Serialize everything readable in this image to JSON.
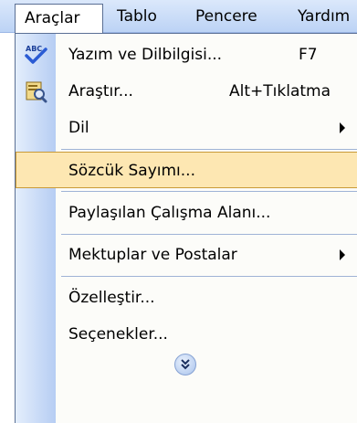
{
  "menubar": {
    "items": [
      {
        "label": "Araçlar"
      },
      {
        "label": "Tablo"
      },
      {
        "label": "Pencere"
      },
      {
        "label": "Yardım"
      }
    ]
  },
  "menu": {
    "items": [
      {
        "label": "Yazım ve Dilbilgisi...",
        "shortcut": "F7",
        "icon": "spelling-check-icon"
      },
      {
        "label": "Araştır...",
        "shortcut": "Alt+Tıklatma",
        "icon": "research-icon"
      },
      {
        "label": "Dil",
        "submenu": true
      },
      {
        "label": "Sözcük Sayımı...",
        "highlighted": true
      },
      {
        "label": "Paylaşılan Çalışma Alanı..."
      },
      {
        "label": "Mektuplar ve Postalar",
        "submenu": true
      },
      {
        "label": "Özelleştir..."
      },
      {
        "label": "Seçenekler..."
      }
    ],
    "expand_icon": "expand-chevron-icon"
  },
  "colors": {
    "highlight_bg": "#fde7b2",
    "highlight_border": "#c99a37",
    "gutter": "#b6cdf3",
    "menubar": "#c7daf6"
  }
}
